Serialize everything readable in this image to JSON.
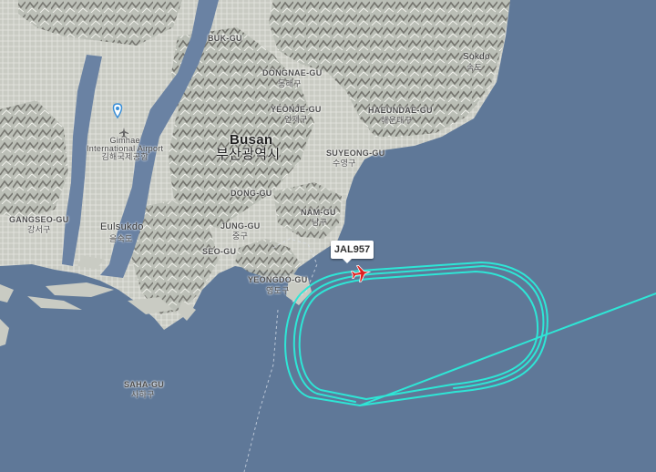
{
  "flight": {
    "callsign": "JAL957",
    "track_color": "#2ee6d6",
    "aircraft_color": "#e02020"
  },
  "labels": {
    "buk_gu": "BUK-GU",
    "dongnae_gu": "DONGNAE-GU",
    "dongnae_ko": "동래구",
    "yeonje_gu": "YEONJE-GU",
    "yeonje_ko": "연제구",
    "haeundae_gu": "HAEUNDAE-GU",
    "haeundae_ko": "해운대구",
    "sokdo": "Sokdo",
    "sokdo_ko": "속도",
    "busan": "Busan",
    "busan_ko": "부산광역시",
    "gimhae_1": "Gimhae",
    "gimhae_2": "International Airport",
    "gimhae_ko": "김해국제공항",
    "suyeong_gu": "SUYEONG-GU",
    "suyeong_ko": "수영구",
    "dong_gu": "DONG-GU",
    "gangseo_gu": "GANGSEO-GU",
    "gangseo_ko": "강서구",
    "eulsukdo": "Eulsukdo",
    "eulsukdo_ko": "을숙도",
    "jung_gu": "JUNG-GU",
    "jung_ko": "중구",
    "nam_gu": "NAM-GU",
    "nam_ko": "남구",
    "seo_gu": "SEO-GU",
    "yeongdo_gu": "YEONGDO-GU",
    "yeongdo_ko": "영도구",
    "saha_gu": "SAHA-GU",
    "saha_ko": "사하구"
  }
}
